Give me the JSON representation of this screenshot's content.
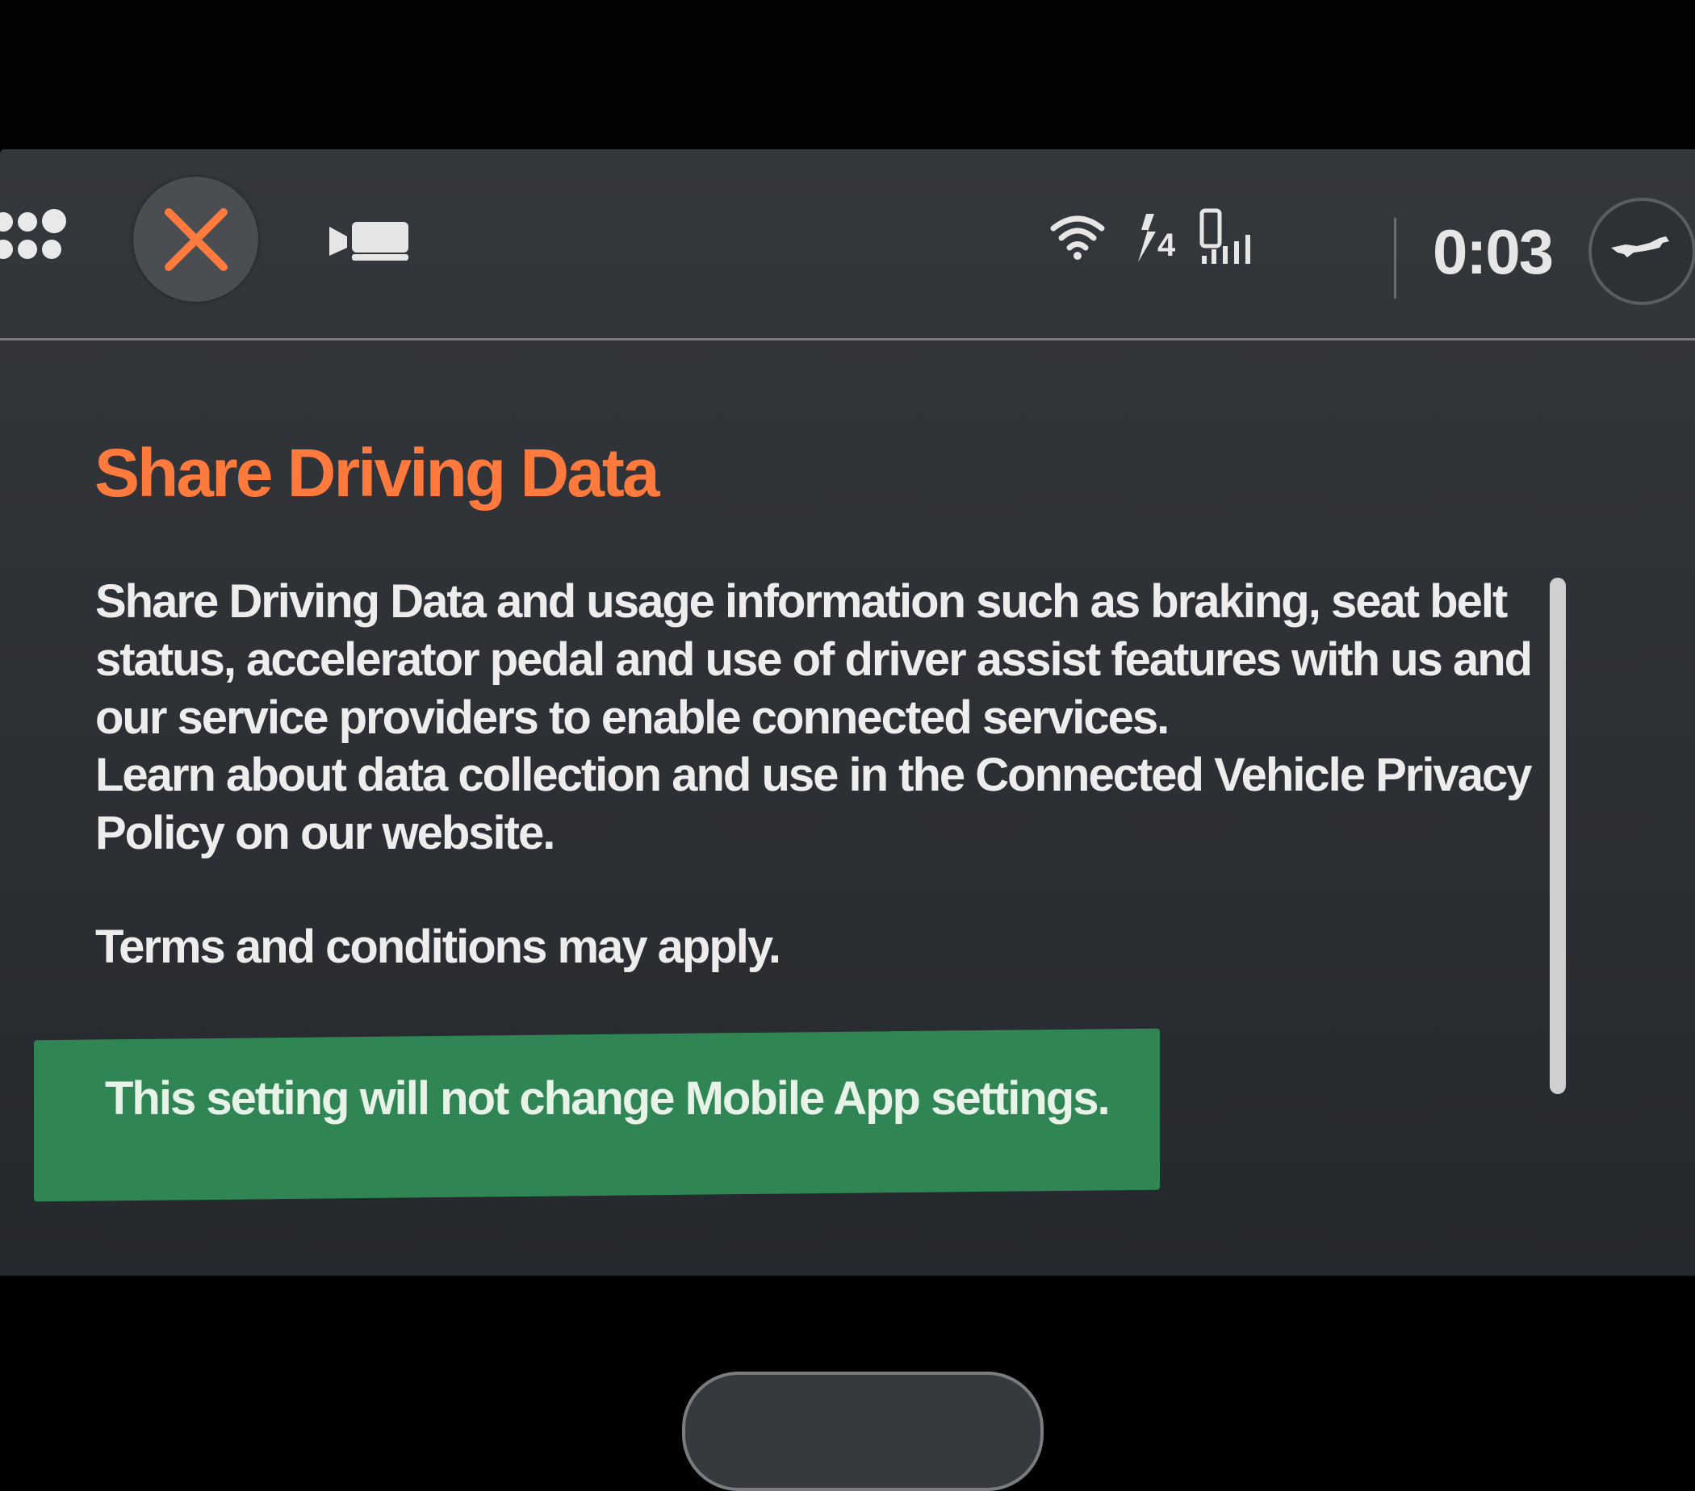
{
  "topbar": {
    "apps_icon": "apps-grid-icon",
    "close_icon": "close-icon",
    "camera_icon": "camera-icon",
    "wifi_icon": "wifi-icon",
    "lte_label": "4",
    "signal_icon": "phone-signal-icon",
    "clock": "0:03",
    "profile_icon": "mustang-logo-icon",
    "accent_color": "#ff7a3c"
  },
  "dialog": {
    "title": "Share Driving Data",
    "paragraphs": [
      "Share Driving Data and usage information such as braking, seat belt status, accelerator pedal and use of driver assist features with us and our service providers to enable connected services.",
      "Learn about data collection and use in the Connected Vehicle Privacy Policy on our website.",
      "Terms and conditions may apply.",
      "This setting will not change Mobile App settings."
    ],
    "highlight_color": "#2f8a55"
  }
}
